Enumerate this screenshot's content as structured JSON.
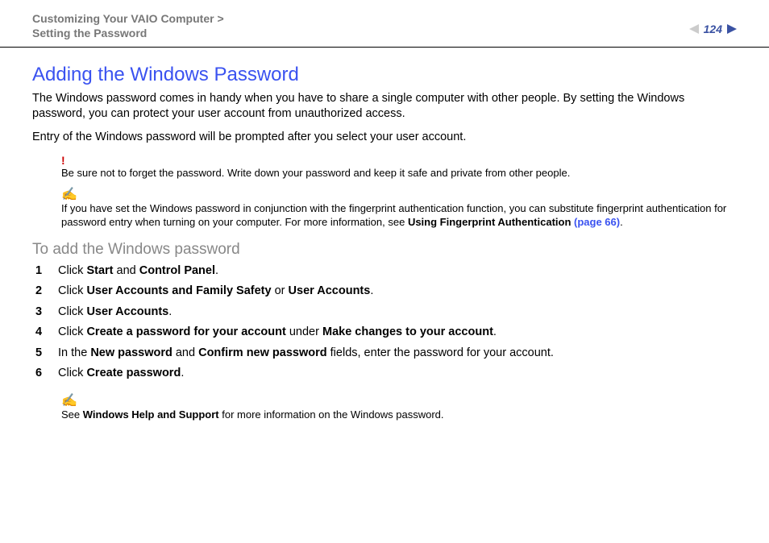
{
  "header": {
    "breadcrumb_line1": "Customizing Your VAIO Computer >",
    "breadcrumb_line2": "Setting the Password",
    "page_number": "124"
  },
  "title": "Adding the Windows Password",
  "para1": "The Windows password comes in handy when you have to share a single computer with other people. By setting the Windows password, you can protect your user account from unauthorized access.",
  "para2": "Entry of the Windows password will be prompted after you select your user account.",
  "warning": {
    "mark": "!",
    "text": "Be sure not to forget the password. Write down your password and keep it safe and private from other people."
  },
  "tip1": {
    "mark": "✍",
    "text_a": "If you have set the Windows password in conjunction with the fingerprint authentication function, you can substitute fingerprint authentication for password entry when turning on your computer. For more information, see ",
    "bold": "Using Fingerprint Authentication ",
    "link": "(page 66)",
    "tail": "."
  },
  "subhead": "To add the Windows password",
  "steps": {
    "s1a": "Click ",
    "s1b": "Start",
    "s1c": " and ",
    "s1d": "Control Panel",
    "s1e": ".",
    "s2a": "Click ",
    "s2b": "User Accounts and Family Safety",
    "s2c": " or ",
    "s2d": "User Accounts",
    "s2e": ".",
    "s3a": "Click ",
    "s3b": "User Accounts",
    "s3c": ".",
    "s4a": "Click ",
    "s4b": "Create a password for your account",
    "s4c": " under ",
    "s4d": "Make changes to your account",
    "s4e": ".",
    "s5a": "In the ",
    "s5b": "New password",
    "s5c": " and ",
    "s5d": "Confirm new password",
    "s5e": " fields, enter the password for your account.",
    "s6a": "Click ",
    "s6b": "Create password",
    "s6c": "."
  },
  "tip2": {
    "mark": "✍",
    "text_a": "See ",
    "bold": "Windows Help and Support",
    "text_b": " for more information on the Windows password."
  }
}
